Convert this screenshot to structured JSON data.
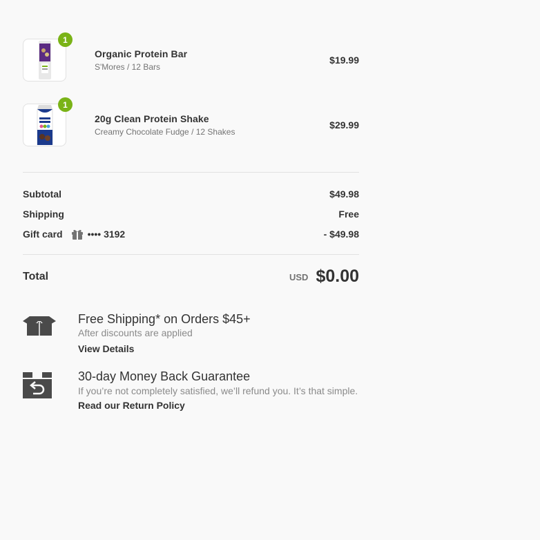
{
  "items": [
    {
      "name": "Organic Protein Bar",
      "variant": "S'Mores / 12 Bars",
      "price": "$19.99",
      "quantity": "1"
    },
    {
      "name": "20g Clean Protein Shake",
      "variant": "Creamy Chocolate Fudge / 12 Shakes",
      "price": "$29.99",
      "quantity": "1"
    }
  ],
  "summary": {
    "subtotal_label": "Subtotal",
    "subtotal_value": "$49.98",
    "shipping_label": "Shipping",
    "shipping_value": "Free",
    "giftcard_label": "Gift card",
    "giftcard_code": "•••• 3192",
    "giftcard_value": "- $49.98"
  },
  "total": {
    "label": "Total",
    "currency": "USD",
    "amount": "$0.00"
  },
  "perks": [
    {
      "title": "Free Shipping* on Orders $45+",
      "subtitle": "After discounts are applied",
      "link": "View Details",
      "icon": "open-box-icon"
    },
    {
      "title": "30-day Money Back Guarantee",
      "subtitle": "If you’re not completely satisfied, we’ll refund you. It’s that simple.",
      "link": "Read our Return Policy",
      "icon": "return-box-icon"
    }
  ],
  "colors": {
    "badge": "#7ab317",
    "text": "#333333",
    "muted": "#737373",
    "background": "#f9f9f9"
  }
}
